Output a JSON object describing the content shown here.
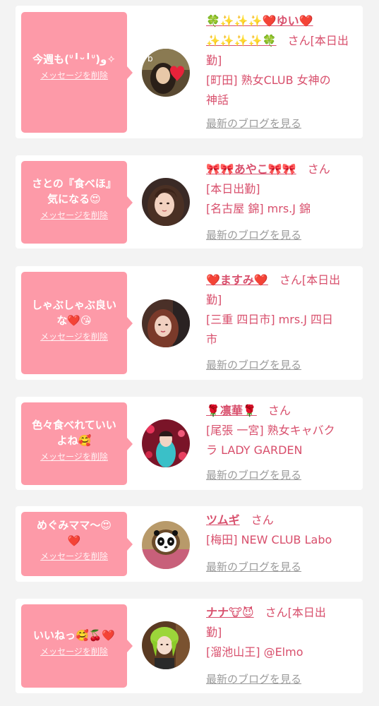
{
  "delete_label": "メッセージを削除",
  "blog_label": "最新のブログを見る",
  "san": "さん",
  "cards": [
    {
      "message_l1": "今週も(ᐡ╹ᵕ╹ᐡ)و✧",
      "message_l2": "",
      "name_l1": "🍀✨✨✨❤️ゆい❤️",
      "name_l2": "✨✨✨✨🍀",
      "status": "[本日出",
      "status_cont": "勤]",
      "shop_l1": "[町田] 熟女CLUB 女神の",
      "shop_l2": "神話"
    },
    {
      "message_l1": "さとの『食べほ』",
      "message_l2": "気になる😍",
      "name_l1": "🎀🎀あやこ🎀🎀",
      "status_cont": "[本日出勤]",
      "shop_l1": "[名古屋 錦] mrs.J 錦"
    },
    {
      "message_l1": "しゃぶしゃぶ良い",
      "message_l2": "な❤️😘",
      "name_l1": "❤️ますみ❤️",
      "status": "[本日出",
      "status_cont": "勤]",
      "shop_l1": "[三重 四日市] mrs.J 四日",
      "shop_l2": "市"
    },
    {
      "message_l1": "色々食べれていい",
      "message_l2": "よね🥰",
      "name_l1": "🌹凛華🌹",
      "shop_l1": "[尾張 一宮] 熟女キャバク",
      "shop_l2": "ラ LADY GARDEN"
    },
    {
      "message_l1": "めぐみママ〜😍",
      "message_l2": "❤️",
      "name_l1": "ツムギ",
      "shop_l1": "[梅田] NEW CLUB Labo"
    },
    {
      "message_l1": "いいねっ🥰🍒❤️",
      "message_l2": "",
      "name_l1": "ナナ🐮😈",
      "status": "[本日出",
      "status_cont": "勤]",
      "shop_l1": "[溜池山王] @Elmo"
    }
  ]
}
